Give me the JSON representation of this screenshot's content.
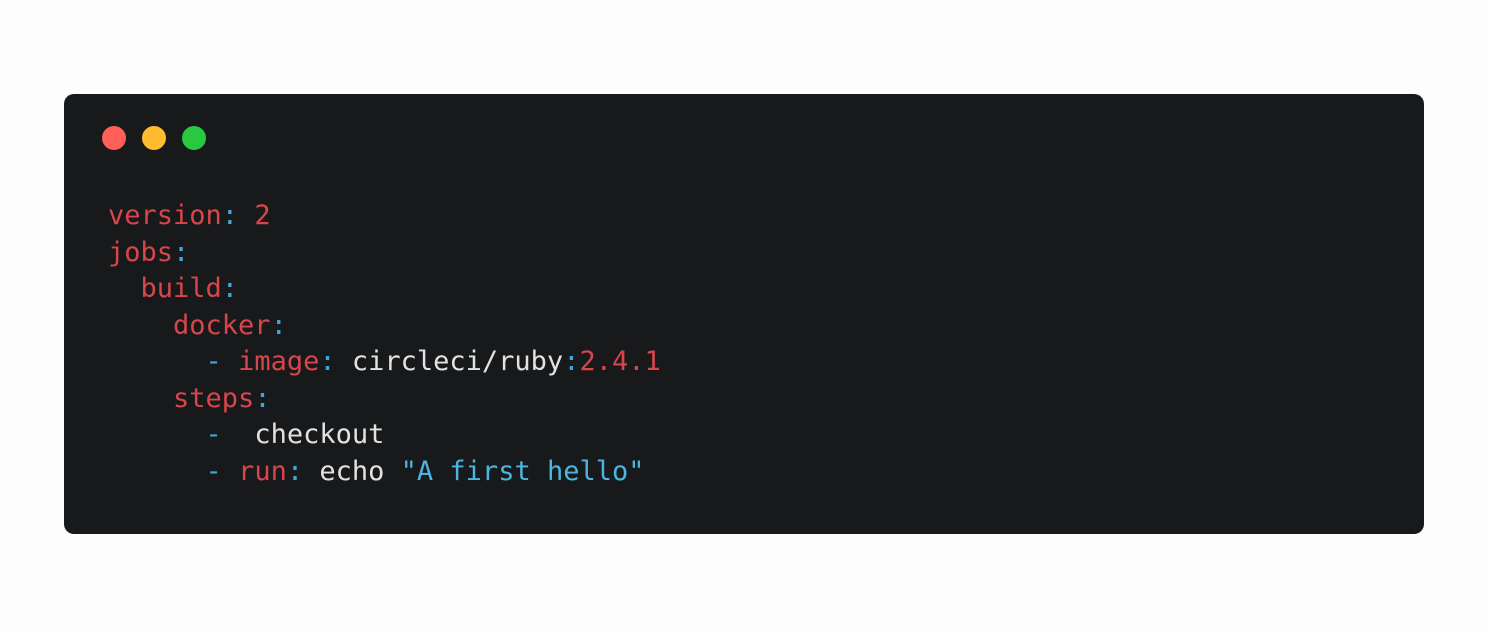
{
  "colors": {
    "page_background": "#fdfdfd",
    "window_background": "#18191b",
    "close_dot": "#ff5f57",
    "minimize_dot": "#febc2e",
    "maximize_dot": "#28c840",
    "key": "#d9454c",
    "punctuation": "#3fa7d6",
    "string": "#4cb5df",
    "plain": "#e2e2e2"
  },
  "code": {
    "language": "yaml",
    "lines": [
      {
        "indent": "",
        "dash": "",
        "key": "version",
        "colon": ":",
        "value": " ",
        "num": "2"
      },
      {
        "indent": "",
        "key": "jobs",
        "colon": ":"
      },
      {
        "indent": "  ",
        "key": "build",
        "colon": ":"
      },
      {
        "indent": "    ",
        "key": "docker",
        "colon": ":"
      },
      {
        "indent": "      ",
        "dash": "-",
        "key": "image",
        "colon": ":",
        "value": " circleci/ruby",
        "colon2": ":",
        "num": "2.4.1"
      },
      {
        "indent": "    ",
        "key": "steps",
        "colon": ":"
      },
      {
        "indent": "      ",
        "dash": "-",
        "value": " checkout"
      },
      {
        "indent": "      ",
        "dash": "-",
        "key": "run",
        "colon": ":",
        "value": " echo ",
        "str": "\"A first hello\""
      }
    ]
  }
}
